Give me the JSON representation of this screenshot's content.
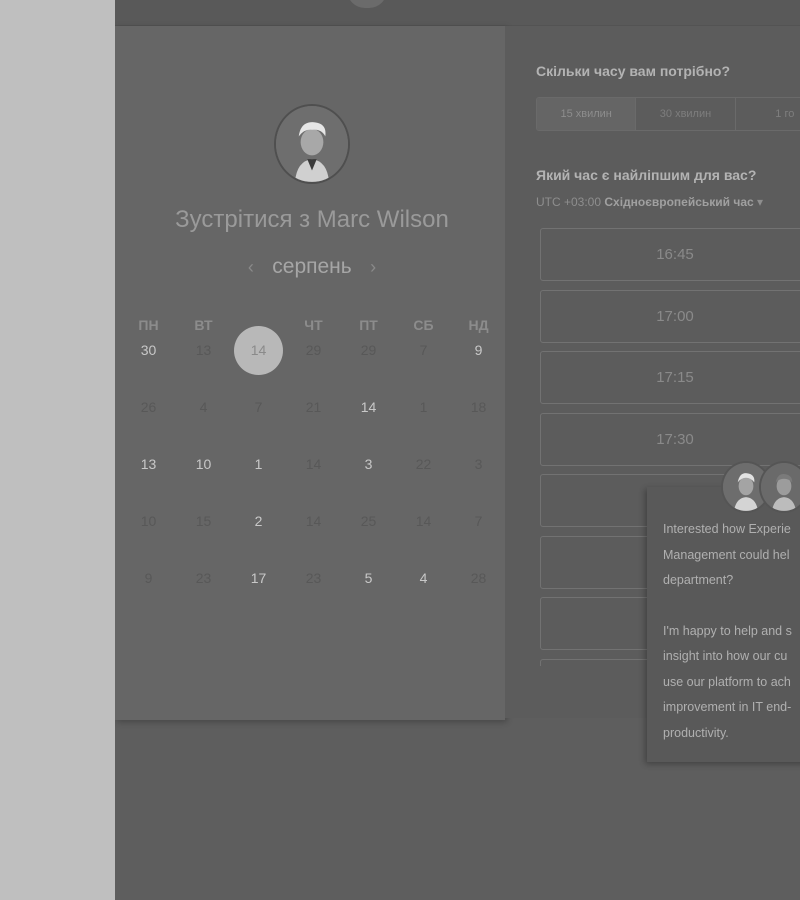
{
  "calendar": {
    "title": "Зустрітися з Marc Wilson",
    "month": "серпень",
    "prev_icon": "‹",
    "next_icon": "›",
    "weekdays": [
      "ПН",
      "ВТ",
      "СР",
      "ЧТ",
      "ПТ",
      "СБ",
      "НД"
    ],
    "weeks": [
      [
        "30",
        "13",
        "14",
        "29",
        "29",
        "7",
        "9"
      ],
      [
        "26",
        "4",
        "7",
        "21",
        "14",
        "1",
        "18"
      ],
      [
        "13",
        "10",
        "1",
        "14",
        "3",
        "22",
        "3"
      ],
      [
        "10",
        "15",
        "2",
        "14",
        "25",
        "14",
        "7"
      ],
      [
        "9",
        "23",
        "17",
        "23",
        "5",
        "4",
        "28"
      ]
    ],
    "selected_day": "14"
  },
  "scheduler": {
    "duration_title": "Скільки часу вам потрібно?",
    "durations": [
      "15 хвилин",
      "30 хвилин",
      "1 го"
    ],
    "time_title": "Який час є найліпшим для вас?",
    "timezone_offset": "UTC +03:00",
    "timezone_name": "Східноєвропейський час",
    "timezone_caret": "▾",
    "slots": [
      "16:45",
      "17:00",
      "17:15",
      "17:30",
      "",
      "",
      "",
      ""
    ]
  },
  "chat": {
    "line1": "Interested how Experie",
    "line2": "Management could hel",
    "line3": "department?",
    "line4": "I'm happy to help and s",
    "line5": "insight into how our cu",
    "line6": "use our platform to ach",
    "line7": "improvement in IT end-",
    "line8": "productivity."
  },
  "colors": {
    "overlay_dark": "#5e5e5e",
    "side_light": "#bfbfbf",
    "selected_day_bg": "#b8b8b8"
  }
}
